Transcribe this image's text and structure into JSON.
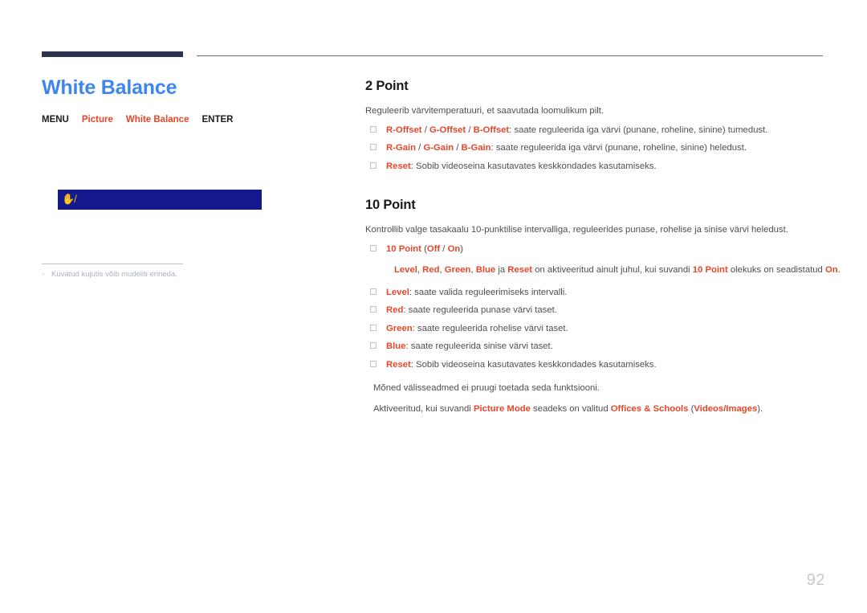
{
  "page": {
    "number": "92",
    "title": "White Balance",
    "title_color": "#3d86f0",
    "accent_color": "#e8462a",
    "rule_color": "#2e3350"
  },
  "menu_path": {
    "items": [
      {
        "label": "MENU",
        "accent": false
      },
      {
        "label": "Picture",
        "accent": true
      },
      {
        "label": "White Balance",
        "accent": true
      },
      {
        "label": "ENTER",
        "accent": false
      }
    ]
  },
  "figure": {
    "icon_name": "hand-pointer-icon",
    "icon_glyph": "✋/",
    "background_color": "#141a8c",
    "note_dash": "-",
    "note": "Kuvatud kujutis võib mudeliti erineda."
  },
  "sections": [
    {
      "heading": "2 Point",
      "lede": "Reguleerib värvitemperatuuri, et saavutada loomulikum pilt.",
      "bullets": [
        {
          "parts": [
            {
              "t": "R-Offset",
              "kw": true
            },
            {
              "t": " / ",
              "kw": false
            },
            {
              "t": "G-Offset",
              "kw": true
            },
            {
              "t": " / ",
              "kw": false
            },
            {
              "t": "B-Offset",
              "kw": true
            },
            {
              "t": ": saate reguleerida iga värvi (punane, roheline, sinine) tumedust.",
              "kw": false
            }
          ]
        },
        {
          "parts": [
            {
              "t": "R-Gain",
              "kw": true
            },
            {
              "t": " / ",
              "kw": false
            },
            {
              "t": "G-Gain",
              "kw": true
            },
            {
              "t": " / ",
              "kw": false
            },
            {
              "t": "B-Gain",
              "kw": true
            },
            {
              "t": ": saate reguleerida iga värvi (punane, roheline, sinine) heledust.",
              "kw": false
            }
          ]
        },
        {
          "parts": [
            {
              "t": "Reset",
              "kw": true
            },
            {
              "t": ": Sobib videoseina kasutavates keskkondades kasutamiseks.",
              "kw": false
            }
          ]
        }
      ]
    },
    {
      "heading": "10 Point",
      "lede": "Kontrollib valge tasakaalu 10-punktilise intervalliga, reguleerides punase, rohelise ja sinise värvi heledust.",
      "bullets": [
        {
          "parts": [
            {
              "t": "10 Point",
              "kw": true
            },
            {
              "t": " (",
              "kw": false
            },
            {
              "t": "Off",
              "kw": true
            },
            {
              "t": " / ",
              "kw": false
            },
            {
              "t": "On",
              "kw": true
            },
            {
              "t": ")",
              "kw": false
            }
          ]
        }
      ],
      "subnote": {
        "parts": [
          {
            "t": "Level",
            "kw": true
          },
          {
            "t": ", ",
            "kw": false
          },
          {
            "t": "Red",
            "kw": true
          },
          {
            "t": ", ",
            "kw": false
          },
          {
            "t": "Green",
            "kw": true
          },
          {
            "t": ", ",
            "kw": false
          },
          {
            "t": "Blue",
            "kw": true
          },
          {
            "t": " ja ",
            "kw": false
          },
          {
            "t": "Reset",
            "kw": true
          },
          {
            "t": " on aktiveeritud ainult juhul, kui suvandi ",
            "kw": false
          },
          {
            "t": "10 Point",
            "kw": true
          },
          {
            "t": " olekuks on seadistatud ",
            "kw": false
          },
          {
            "t": "On",
            "kw": true
          },
          {
            "t": ".",
            "kw": false
          }
        ]
      },
      "bullets_after": [
        {
          "parts": [
            {
              "t": "Level",
              "kw": true
            },
            {
              "t": ": saate valida reguleerimiseks intervalli.",
              "kw": false
            }
          ]
        },
        {
          "parts": [
            {
              "t": "Red",
              "kw": true
            },
            {
              "t": ": saate reguleerida punase värvi taset.",
              "kw": false
            }
          ]
        },
        {
          "parts": [
            {
              "t": "Green",
              "kw": true
            },
            {
              "t": ": saate reguleerida rohelise värvi taset.",
              "kw": false
            }
          ]
        },
        {
          "parts": [
            {
              "t": "Blue",
              "kw": true
            },
            {
              "t": ": saate reguleerida sinise värvi taset.",
              "kw": false
            }
          ]
        },
        {
          "parts": [
            {
              "t": "Reset",
              "kw": true
            },
            {
              "t": ": Sobib videoseina kasutavates keskkondades kasutamiseks.",
              "kw": false
            }
          ]
        }
      ],
      "tail_notes": [
        {
          "parts": [
            {
              "t": "Mõned välisseadmed ei pruugi toetada seda funktsiooni.",
              "kw": false
            }
          ]
        },
        {
          "parts": [
            {
              "t": "Aktiveeritud, kui suvandi ",
              "kw": false
            },
            {
              "t": "Picture Mode",
              "kw": true
            },
            {
              "t": " seadeks on valitud ",
              "kw": false
            },
            {
              "t": "Offices & Schools",
              "kw": true
            },
            {
              "t": " (",
              "kw": false
            },
            {
              "t": "Videos/Images",
              "kw": true
            },
            {
              "t": ").",
              "kw": false
            }
          ]
        }
      ]
    }
  ]
}
